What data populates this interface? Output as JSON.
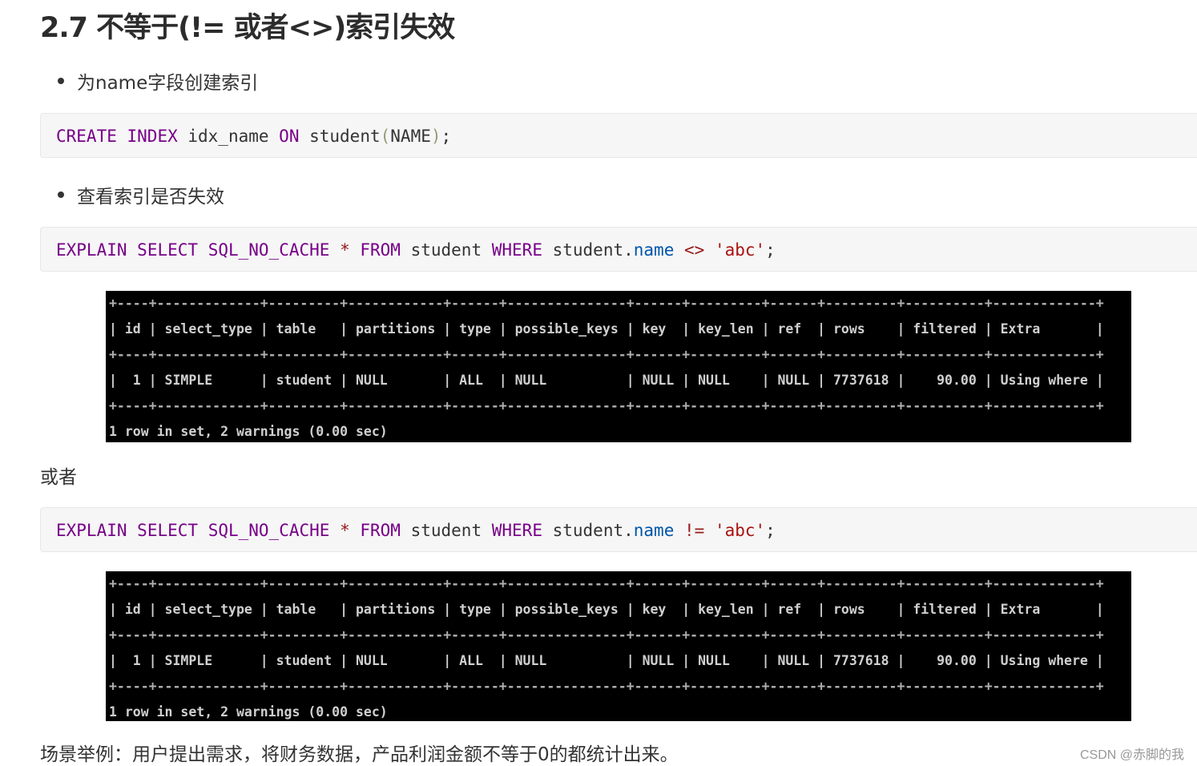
{
  "heading": "2.7 不等于(!= 或者<>)索引失效",
  "bullets": [
    "为name字段创建索引",
    "查看索引是否失效"
  ],
  "code_blocks": [
    {
      "tokens": [
        {
          "t": "CREATE",
          "c": "kw"
        },
        {
          "t": " ",
          "c": "fn"
        },
        {
          "t": "INDEX",
          "c": "kw"
        },
        {
          "t": " idx_name ",
          "c": "fn"
        },
        {
          "t": "ON",
          "c": "kw"
        },
        {
          "t": " student",
          "c": "fn"
        },
        {
          "t": "(",
          "c": "pr"
        },
        {
          "t": "NAME",
          "c": "fn"
        },
        {
          "t": ")",
          "c": "pr"
        },
        {
          "t": ";",
          "c": "fn"
        }
      ]
    },
    {
      "tokens": [
        {
          "t": "EXPLAIN",
          "c": "kw"
        },
        {
          "t": " ",
          "c": "fn"
        },
        {
          "t": "SELECT",
          "c": "kw"
        },
        {
          "t": " ",
          "c": "fn"
        },
        {
          "t": "SQL_NO_CACHE",
          "c": "kw"
        },
        {
          "t": " ",
          "c": "fn"
        },
        {
          "t": "*",
          "c": "op"
        },
        {
          "t": " ",
          "c": "fn"
        },
        {
          "t": "FROM",
          "c": "kw"
        },
        {
          "t": " student ",
          "c": "fn"
        },
        {
          "t": "WHERE",
          "c": "kw"
        },
        {
          "t": " student.",
          "c": "fn"
        },
        {
          "t": "name",
          "c": "var"
        },
        {
          "t": " ",
          "c": "fn"
        },
        {
          "t": "<>",
          "c": "op"
        },
        {
          "t": " ",
          "c": "fn"
        },
        {
          "t": "'abc'",
          "c": "str"
        },
        {
          "t": ";",
          "c": "fn"
        }
      ]
    },
    {
      "tokens": [
        {
          "t": "EXPLAIN",
          "c": "kw"
        },
        {
          "t": " ",
          "c": "fn"
        },
        {
          "t": "SELECT",
          "c": "kw"
        },
        {
          "t": " ",
          "c": "fn"
        },
        {
          "t": "SQL_NO_CACHE",
          "c": "kw"
        },
        {
          "t": " ",
          "c": "fn"
        },
        {
          "t": "*",
          "c": "op"
        },
        {
          "t": " ",
          "c": "fn"
        },
        {
          "t": "FROM",
          "c": "kw"
        },
        {
          "t": " student ",
          "c": "fn"
        },
        {
          "t": "WHERE",
          "c": "kw"
        },
        {
          "t": " student.",
          "c": "fn"
        },
        {
          "t": "name",
          "c": "var"
        },
        {
          "t": " ",
          "c": "fn"
        },
        {
          "t": "!=",
          "c": "op"
        },
        {
          "t": " ",
          "c": "fn"
        },
        {
          "t": "'abc'",
          "c": "str"
        },
        {
          "t": ";",
          "c": "fn"
        }
      ]
    }
  ],
  "or_text": "或者",
  "explain_result": {
    "columns": [
      "id",
      "select_type",
      "table",
      "partitions",
      "type",
      "possible_keys",
      "key",
      "key_len",
      "ref",
      "rows",
      "filtered",
      "Extra"
    ],
    "rows": [
      [
        "1",
        "SIMPLE",
        "student",
        "NULL",
        "ALL",
        "NULL",
        "NULL",
        "NULL",
        "NULL",
        "7737618",
        "90.00",
        "Using where"
      ]
    ],
    "summary": "1 row in set, 2 warnings (0.00 sec)"
  },
  "footer_text": "场景举例：用户提出需求，将财务数据，产品利润金额不等于0的都统计出来。",
  "watermark": "CSDN @赤脚的我"
}
